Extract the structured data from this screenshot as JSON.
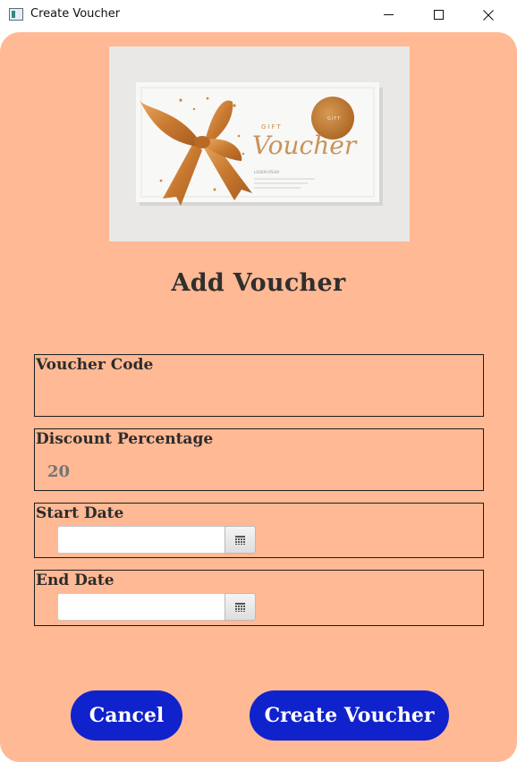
{
  "window": {
    "title": "Create Voucher",
    "icon": "app-window-icon"
  },
  "banner": {
    "small_caps": "GIFT",
    "script_word": "Voucher",
    "seal_text": "GIFT",
    "fine_print": "LOREM IPSUM"
  },
  "form": {
    "heading": "Add Voucher",
    "voucher_code": {
      "label": "Voucher Code",
      "value": "",
      "placeholder": ""
    },
    "discount": {
      "label": "Discount Percentage",
      "value": "",
      "placeholder": "20"
    },
    "start_date": {
      "label": "Start Date",
      "value": "",
      "icon": "calendar-icon"
    },
    "end_date": {
      "label": "End Date",
      "value": "",
      "icon": "calendar-icon"
    }
  },
  "actions": {
    "cancel_label": "Cancel",
    "create_label": "Create Voucher"
  },
  "colors": {
    "background": "#ffb994",
    "button": "#1022cc",
    "text": "#2f2f2f"
  }
}
